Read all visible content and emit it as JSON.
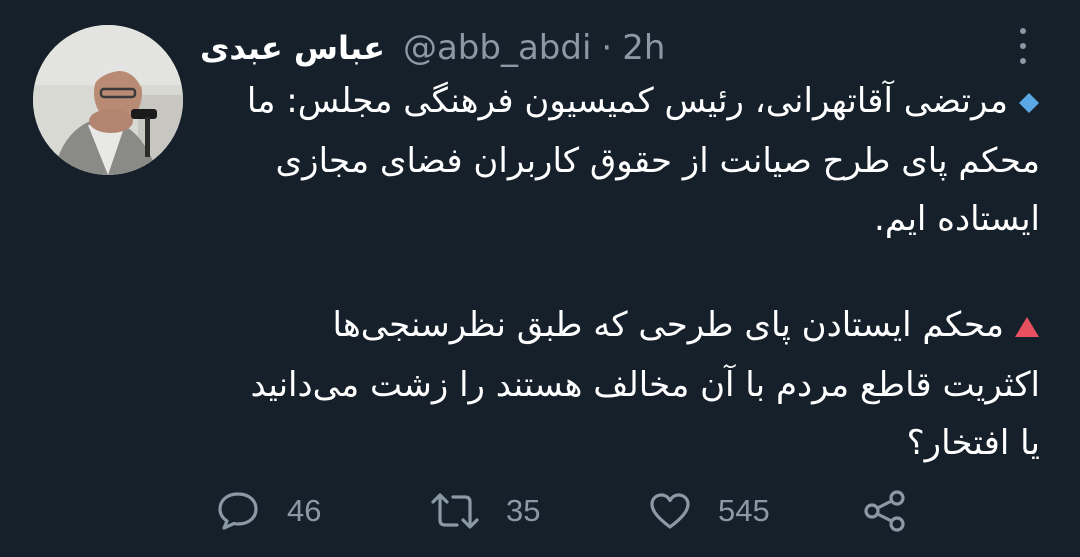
{
  "tweet": {
    "display_name": "عباس عبدی",
    "handle": "@abb_abdi",
    "separator": "·",
    "time": "2h",
    "paragraph1": {
      "emoji": "blue-diamond-icon",
      "lines": [
        "مرتضی آقاتهرانی، رئیس کمیسیون فرهنگی مجلس: ما",
        "محکم پای طرح صیانت از حقوق کاربران فضای مجازی",
        "ایستاده ایم."
      ]
    },
    "paragraph2": {
      "emoji": "red-triangle-icon",
      "lines": [
        "محکم ایستادن پای طرحی که طبق نظرسنجی‌ها",
        "اکثریت قاطع مردم با آن مخالف هستند را زشت می‌دانید",
        "یا افتخار؟"
      ]
    }
  },
  "actions": {
    "reply_count": "46",
    "retweet_count": "35",
    "like_count": "545"
  },
  "colors": {
    "background": "#15202b",
    "text": "#ffffff",
    "secondary_text": "#8b98a5",
    "diamond": "#5aa9e6",
    "triangle": "#e6505f"
  }
}
